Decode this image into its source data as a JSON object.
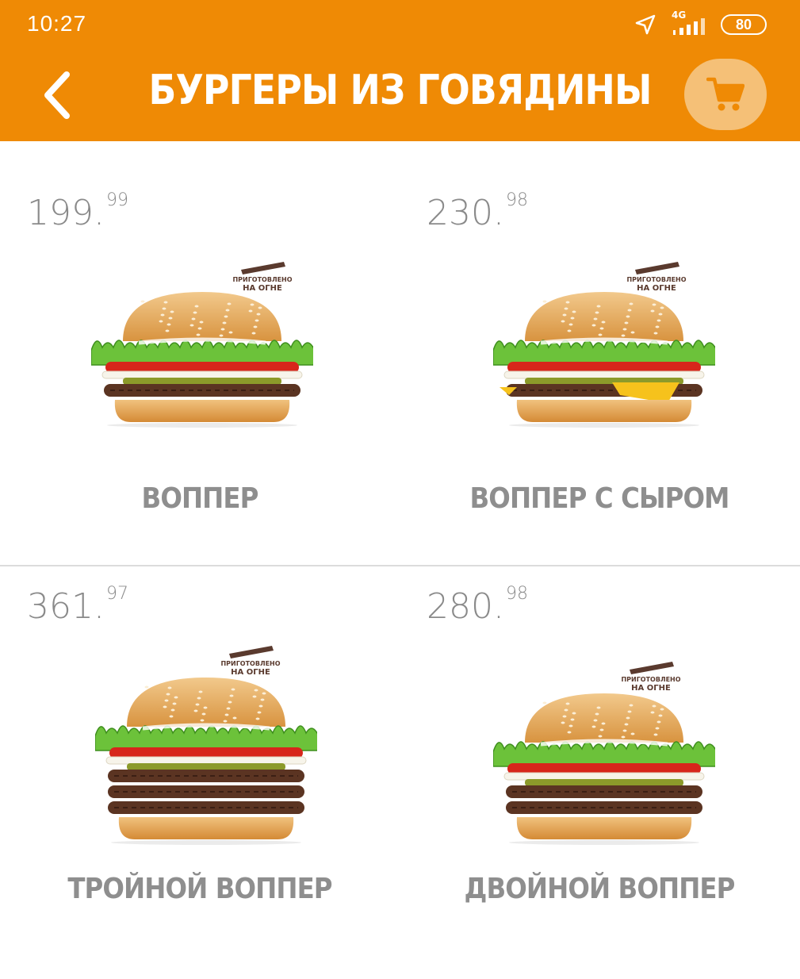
{
  "status_bar": {
    "time": "10:27",
    "network": "4G",
    "battery": "80"
  },
  "header": {
    "title": "БУРГЕРЫ ИЗ ГОВЯДИНЫ"
  },
  "icons": {
    "back": "chevron-left-icon",
    "cart": "cart-icon",
    "location": "location-arrow-icon",
    "signal": "signal-icon"
  },
  "badge_text": [
    "ПРИГОТОВЛЕНО",
    "НА ОГНЕ"
  ],
  "colors": {
    "header": "#ef8a05",
    "cart_bg": "#f5c077",
    "text_gray": "#8e8e8e"
  },
  "products": [
    {
      "price_main": "199.",
      "price_cents": "99",
      "name": "ВОППЕР"
    },
    {
      "price_main": "230.",
      "price_cents": "98",
      "name": "ВОППЕР С СЫРОМ"
    },
    {
      "price_main": "361.",
      "price_cents": "97",
      "name": "ТРОЙНОЙ ВОППЕР"
    },
    {
      "price_main": "280.",
      "price_cents": "98",
      "name": "ДВОЙНОЙ ВОППЕР"
    }
  ]
}
